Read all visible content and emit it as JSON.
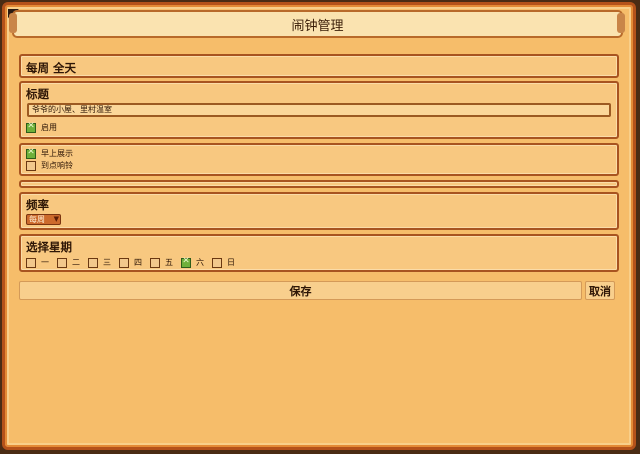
{
  "window": {
    "title": "闹钟管理"
  },
  "summary": {
    "text": "每周 全天"
  },
  "title_section": {
    "heading": "标题",
    "input_value": "爷爷的小屋、里村温室",
    "enabled": {
      "label": "启用",
      "checked": true
    }
  },
  "notify_section": {
    "morning_show": {
      "label": "早上展示",
      "checked": true
    },
    "ring_on_time": {
      "label": "到点响铃",
      "checked": false
    }
  },
  "frequency_section": {
    "heading": "频率",
    "selected": "每周",
    "arrow_icon": "triangle-down"
  },
  "weekday_section": {
    "heading": "选择星期",
    "days": [
      {
        "label": "一",
        "checked": false
      },
      {
        "label": "二",
        "checked": false
      },
      {
        "label": "三",
        "checked": false
      },
      {
        "label": "四",
        "checked": false
      },
      {
        "label": "五",
        "checked": false
      },
      {
        "label": "六",
        "checked": true
      },
      {
        "label": "日",
        "checked": false
      }
    ]
  },
  "actions": {
    "save_label": "保存",
    "cancel_label": "取消"
  },
  "colors": {
    "panel_bg": "#f6bd6a",
    "border": "#a85420",
    "checked_green": "#6fb03a",
    "dropdown_bg": "#cc6a2c"
  }
}
